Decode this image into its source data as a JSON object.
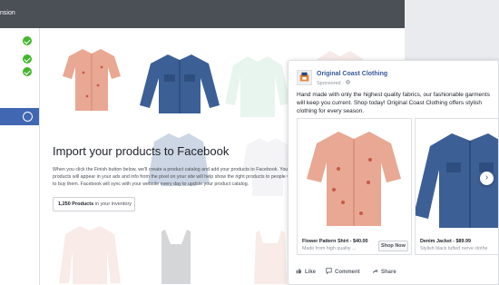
{
  "window": {
    "title_fragment": "nsion"
  },
  "sidebar": {
    "completed_steps": 3,
    "active_step": 4
  },
  "import": {
    "title": "Import your products to Facebook",
    "body": "When you click the Finish button below, we'll create a product catalog and add your products to Facebook. Your products will appear in your ads and info from the pixel on your site will help show the right products to people who want to buy them. Facebook will sync with your website every day to update your product catalog.",
    "count_value": "1,250 Products",
    "count_suffix": " in your inventory"
  },
  "ad": {
    "page_name": "Original Coast Clothing",
    "sponsored": "Sponsored · ",
    "text": "Hand made with only the highest quality fabrics, our fashionable garments will keep you current. Shop today! Original Coast Clothing offers stylish clothing for every season.",
    "cards": [
      {
        "title": "Flower Pattern Shirt - $40.00",
        "description": "Made from high quality ...",
        "cta": "Shop Now"
      },
      {
        "title": "Denim Jacket - $89.99",
        "description": "Stylish black tufted nerve clothe"
      }
    ],
    "actions": {
      "like": "Like",
      "comment": "Comment",
      "share": "Share"
    }
  },
  "colors": {
    "brand": "#4267b2",
    "check": "#42b72a",
    "link": "#365899",
    "shirt": "#e9a893",
    "denim": "#3c5f96"
  }
}
